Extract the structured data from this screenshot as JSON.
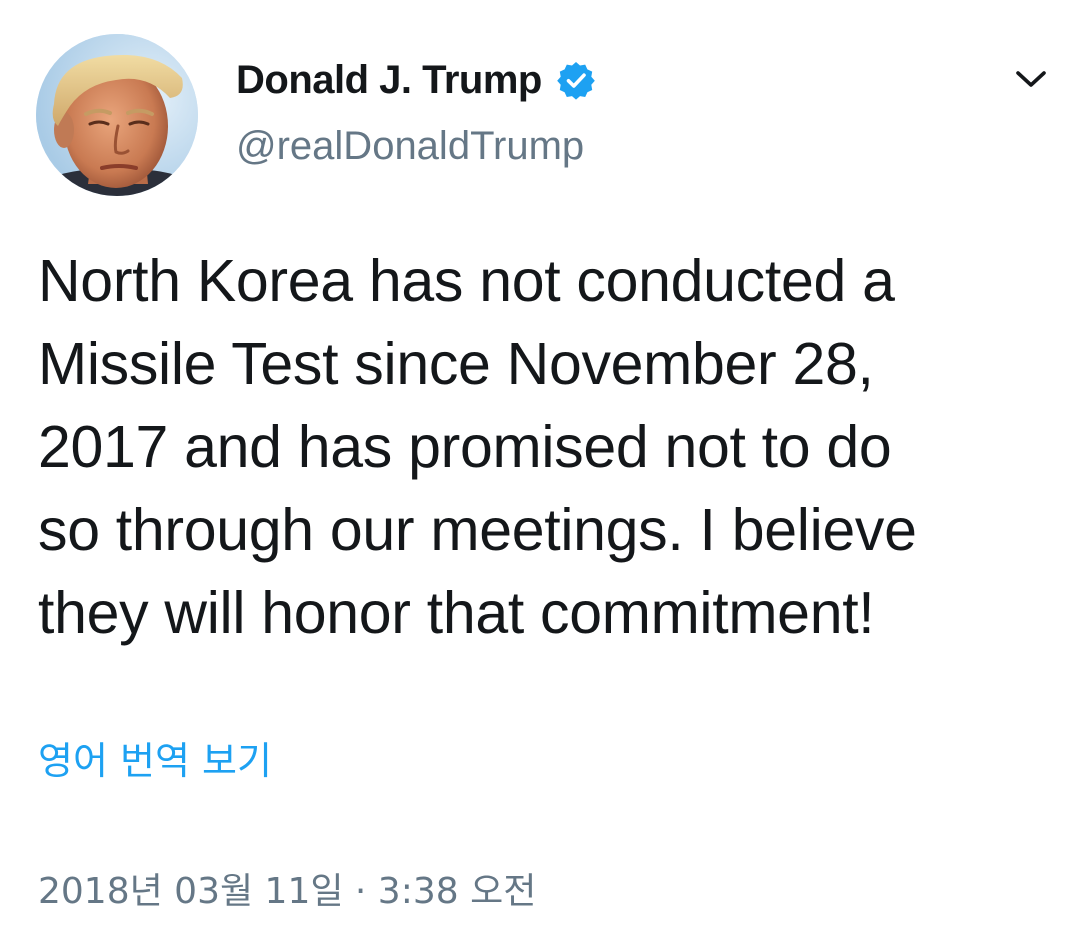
{
  "author": {
    "display_name": "Donald J. Trump",
    "handle": "@realDonaldTrump",
    "verified": true,
    "avatar_icon": "avatar-portrait"
  },
  "tweet": {
    "lines": [
      "North Korea has not conducted a",
      "Missile Test since November 28,",
      "2017 and has promised not to do",
      "so through our meetings. I believe",
      "they will honor that commitment!"
    ]
  },
  "translate": {
    "label": "영어 번역 보기"
  },
  "meta": {
    "timestamp": "2018년 03월 11일 · 3:38 오전"
  },
  "icons": {
    "verified": "verified-badge-icon",
    "menu": "chevron-down-icon"
  },
  "colors": {
    "verified_blue": "#1da1f2",
    "link_blue": "#1da1f2",
    "secondary_text": "#657786",
    "primary_text": "#14171a"
  }
}
